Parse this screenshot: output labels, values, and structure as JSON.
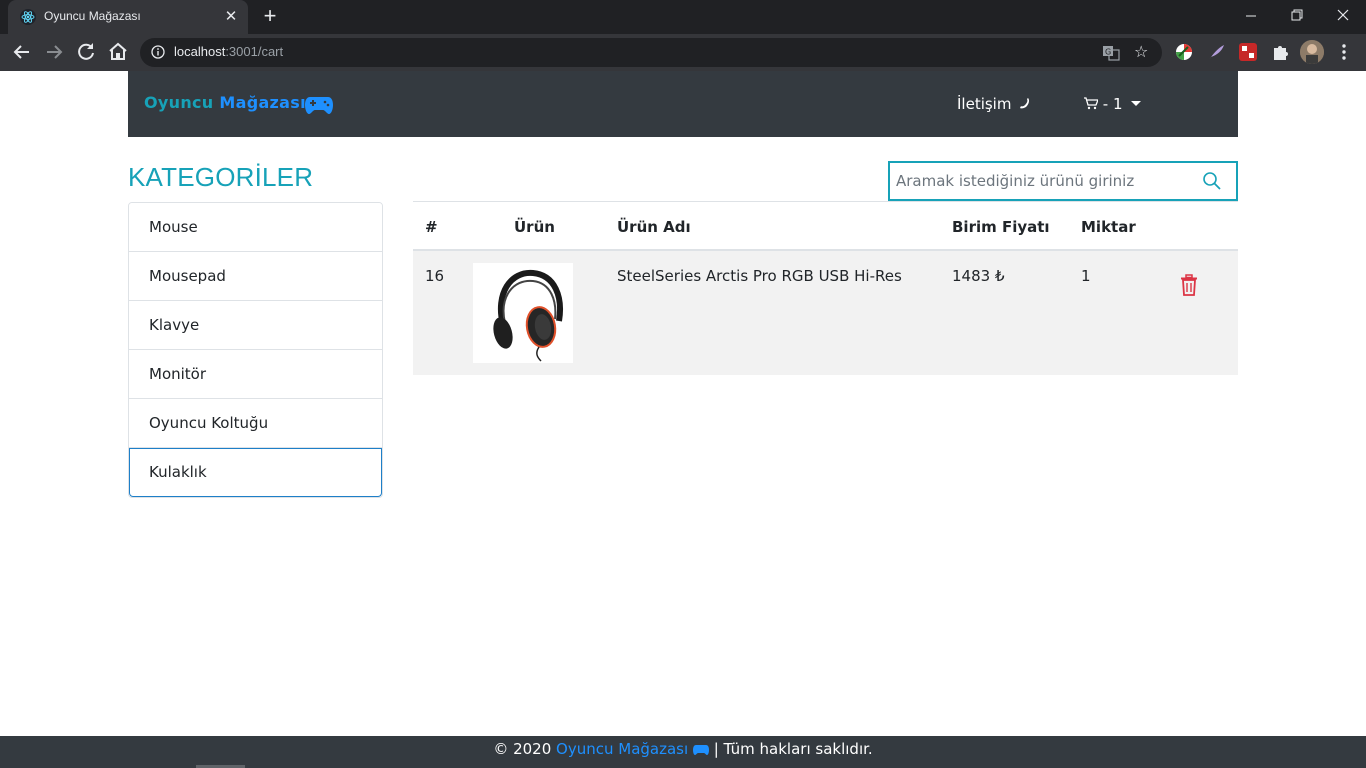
{
  "browser": {
    "tab_title": "Oyuncu Mağazası",
    "url_host": "localhost",
    "url_rest": ":3001/cart"
  },
  "navbar": {
    "brand_part1": "Oyuncu",
    "brand_part2": "Mağazası",
    "contact_label": "İletişim",
    "cart_label": "- 1"
  },
  "sidebar": {
    "title": "KATEGORİLER",
    "items": [
      "Mouse",
      "Mousepad",
      "Klavye",
      "Monitör",
      "Oyuncu Koltuğu",
      "Kulaklık"
    ],
    "active_index": 5
  },
  "search": {
    "placeholder": "Aramak istediğiniz ürünü giriniz"
  },
  "cart_table": {
    "headers": [
      "#",
      "Ürün",
      "Ürün Adı",
      "Birim Fiyatı",
      "Miktar"
    ],
    "rows": [
      {
        "id": "16",
        "name": "SteelSeries Arctis Pro RGB USB Hi-Res",
        "price": "1483 ₺",
        "quantity": "1"
      }
    ]
  },
  "footer": {
    "copyright": "© 2020",
    "brand": "Oyuncu Mağazası",
    "rights": "| Tüm hakları saklıdır."
  },
  "colors": {
    "accent": "#17a2b8",
    "brand_blue": "#1e90ff",
    "navbar_bg": "#343a40",
    "danger": "#dc3545"
  }
}
